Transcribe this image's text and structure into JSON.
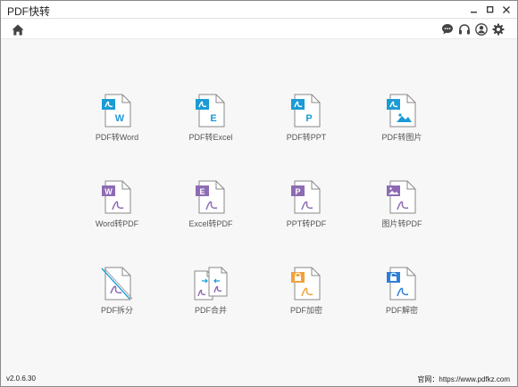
{
  "window": {
    "title": "PDF快转"
  },
  "colors": {
    "blue": "#1b9bd6",
    "purple": "#8e6bb4",
    "orange": "#f2a13a",
    "lockblue": "#2f7fd8",
    "gray": "#7c7c7c"
  },
  "tiles_row1": [
    {
      "label": "PDF转Word",
      "letter": "W",
      "icon": "pdf-to-word-icon"
    },
    {
      "label": "PDF转Excel",
      "letter": "E",
      "icon": "pdf-to-excel-icon"
    },
    {
      "label": "PDF转PPT",
      "letter": "P",
      "icon": "pdf-to-ppt-icon"
    },
    {
      "label": "PDF转图片",
      "letter": "",
      "icon": "pdf-to-image-icon"
    }
  ],
  "tiles_row2": [
    {
      "label": "Word转PDF",
      "letter": "W",
      "icon": "word-to-pdf-icon"
    },
    {
      "label": "Excel转PDF",
      "letter": "E",
      "icon": "excel-to-pdf-icon"
    },
    {
      "label": "PPT转PDF",
      "letter": "P",
      "icon": "ppt-to-pdf-icon"
    },
    {
      "label": "图片转PDF",
      "letter": "",
      "icon": "image-to-pdf-icon"
    }
  ],
  "tiles_row3": [
    {
      "label": "PDF拆分",
      "icon": "pdf-split-icon"
    },
    {
      "label": "PDF合并",
      "icon": "pdf-merge-icon"
    },
    {
      "label": "PDF加密",
      "icon": "pdf-encrypt-icon"
    },
    {
      "label": "PDF解密",
      "icon": "pdf-decrypt-icon"
    }
  ],
  "footer": {
    "version": "v2.0.6.30",
    "site": "官网：https://www.pdfkz.com"
  }
}
